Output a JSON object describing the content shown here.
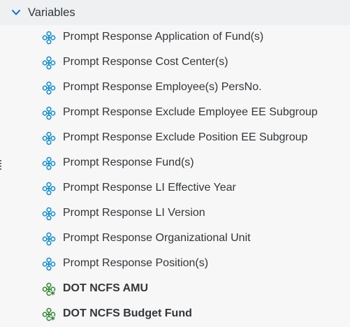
{
  "section": {
    "title": "Variables",
    "chevron_icon": "chevron-down-icon"
  },
  "colors": {
    "prompt_icon": "#1a8fc9",
    "measure_icon": "#3b8a3e",
    "text": "#32363a",
    "header_bg": "#eef0f2"
  },
  "items": [
    {
      "label": "Prompt Response Application of Fund(s)",
      "icon": "prompt-variable-icon",
      "bold": false
    },
    {
      "label": "Prompt Response Cost Center(s)",
      "icon": "prompt-variable-icon",
      "bold": false
    },
    {
      "label": "Prompt Response Employee(s) PersNo.",
      "icon": "prompt-variable-icon",
      "bold": false
    },
    {
      "label": "Prompt Response Exclude Employee EE Subgroup",
      "icon": "prompt-variable-icon",
      "bold": false
    },
    {
      "label": "Prompt Response Exclude Position EE Subgroup",
      "icon": "prompt-variable-icon",
      "bold": false
    },
    {
      "label": "Prompt Response Fund(s)",
      "icon": "prompt-variable-icon",
      "bold": false
    },
    {
      "label": "Prompt Response LI Effective Year",
      "icon": "prompt-variable-icon",
      "bold": false
    },
    {
      "label": "Prompt Response LI Version",
      "icon": "prompt-variable-icon",
      "bold": false
    },
    {
      "label": "Prompt Response Organizational Unit",
      "icon": "prompt-variable-icon",
      "bold": false
    },
    {
      "label": "Prompt Response Position(s)",
      "icon": "prompt-variable-icon",
      "bold": false
    },
    {
      "label": "DOT NCFS AMU",
      "icon": "measure-variable-icon",
      "bold": true
    },
    {
      "label": "DOT NCFS Budget Fund",
      "icon": "measure-variable-icon",
      "bold": true
    }
  ]
}
